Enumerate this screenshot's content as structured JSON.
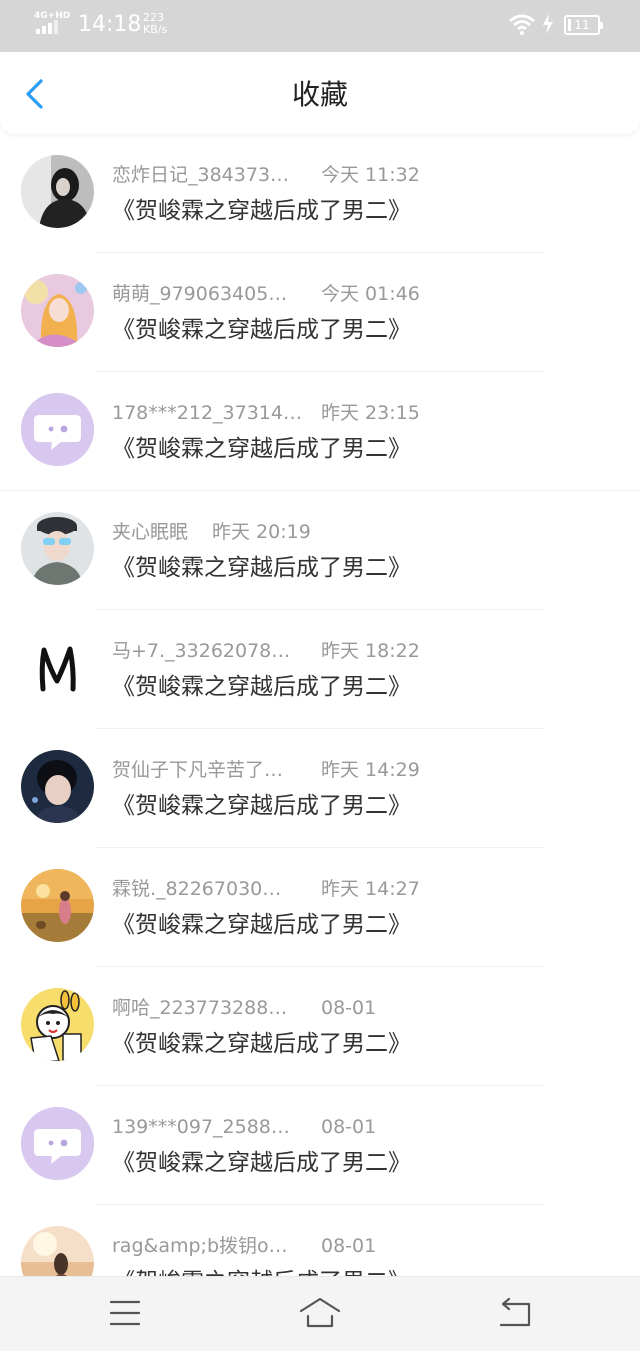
{
  "status_bar": {
    "network": "4G+HD",
    "time": "14:18",
    "speed_value": "223",
    "speed_unit": "KB/s",
    "battery": "11"
  },
  "header": {
    "title": "收藏",
    "back_icon": "chevron-left-icon"
  },
  "colors": {
    "accent": "#2a9df4",
    "status_bar_bg": "#d6d6d6",
    "meta_text": "#999999",
    "title_text": "#333333"
  },
  "items": [
    {
      "user": "恋炸日记_384373…",
      "time": "今天 11:32",
      "title": "《贺峻霖之穿越后成了男二》",
      "avatar": "photo-girl-bw"
    },
    {
      "user": "萌萌_979063405…",
      "time": "今天 01:46",
      "title": "《贺峻霖之穿越后成了男二》",
      "avatar": "anime-girl-pink"
    },
    {
      "user": "178***212_37314…",
      "time": "昨天 23:15",
      "title": "《贺峻霖之穿越后成了男二》",
      "avatar": "default-chat-bubble"
    },
    {
      "user": "夹心眠眠",
      "time": "昨天 20:19",
      "title": "《贺峻霖之穿越后成了男二》",
      "avatar": "photo-boy-cap-sunglasses"
    },
    {
      "user": "马+7._33262078…",
      "time": "昨天 18:22",
      "title": "《贺峻霖之穿越后成了男二》",
      "avatar": "letter-m"
    },
    {
      "user": "贺仙子下凡辛苦了…",
      "time": "昨天 14:29",
      "title": "《贺峻霖之穿越后成了男二》",
      "avatar": "photo-boy-dark"
    },
    {
      "user": "霖锐._82267030…",
      "time": "昨天 14:27",
      "title": "《贺峻霖之穿越后成了男二》",
      "avatar": "photo-sunset"
    },
    {
      "user": "啊哈_223773288…",
      "time": "08-01",
      "title": "《贺峻霖之穿越后成了男二》",
      "avatar": "cartoon-kid"
    },
    {
      "user": "139***097_2588…",
      "time": "08-01",
      "title": "《贺峻霖之穿越后成了男二》",
      "avatar": "default-chat-bubble"
    },
    {
      "user": "rag&amp;b拨钥o…",
      "time": "08-01",
      "title": "《贺峻霖之穿越后成了男二》",
      "avatar": "photo-girl-sunlight"
    }
  ],
  "nav": {
    "menu_icon": "menu-icon",
    "home_icon": "home-icon",
    "back_icon": "return-icon"
  }
}
